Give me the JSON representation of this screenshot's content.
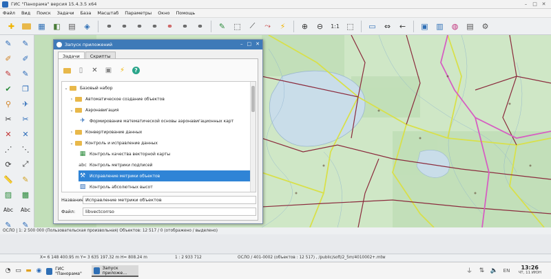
{
  "window": {
    "title": "ГИС \"Панорама\" версия 15.4.3.5 x64"
  },
  "menu": [
    "Файл",
    "Вид",
    "Поиск",
    "Задачи",
    "База",
    "Масштаб",
    "Параметры",
    "Окно",
    "Помощь"
  ],
  "toolbar": {
    "scale_label": "1:1"
  },
  "left_tools": {
    "text_label_1": "Abc",
    "text_label_2": "Abc"
  },
  "dialog": {
    "title": "Запуск приложений",
    "tabs": [
      "Задачи",
      "Скрипты"
    ],
    "tree": [
      {
        "label": "Базовый набор",
        "level": 0,
        "kind": "folder",
        "expanded": true
      },
      {
        "label": "Автоматическое создание объектов",
        "level": 1,
        "kind": "folder",
        "expanded": false
      },
      {
        "label": "Аэронавигация",
        "level": 1,
        "kind": "folder",
        "expanded": true
      },
      {
        "label": "Формирование математической основы аэронавигационных карт",
        "level": 2,
        "kind": "task"
      },
      {
        "label": "Конвертирование данных",
        "level": 1,
        "kind": "folder",
        "expanded": false
      },
      {
        "label": "Контроль и исправление данных",
        "level": 1,
        "kind": "folder",
        "expanded": true
      },
      {
        "label": "Контроль качества векторной карты",
        "level": 2,
        "kind": "task"
      },
      {
        "label": "Контроль метрики подписей",
        "level": 2,
        "kind": "task",
        "icon_text": "abc"
      },
      {
        "label": "Исправление метрики объектов",
        "level": 2,
        "kind": "task",
        "selected": true
      },
      {
        "label": "Контроль абсолютных высот",
        "level": 2,
        "kind": "task"
      }
    ],
    "name_label": "Название:",
    "name_value": "Исправление метрики объектов",
    "file_label": "Файл:",
    "file_value": "libvectcorrso"
  },
  "status": {
    "line1": "ОСЛО | 1: 2 500 000 (Пользовательская произвольная) Объектов: 12 517 / 0 (отображено / выделено)",
    "coords": "X= 6 148 400.95 m  Y= 3 635 197.32 m  H= 808.24 m",
    "scale": "1 : 2 933 712",
    "path": "ОСЛО / 401-0002  (объектов : 12 517) , /public/soft/2_5m/4010002+.mtw"
  },
  "taskbar": {
    "tasks": [
      "ГИС \"Панорама\"",
      "Запуск приложе..."
    ],
    "time": "13:26",
    "date": "ЧТ, 11 ИЮН"
  },
  "colors": {
    "map_land": "#cfe7c6",
    "water": "#c9dde9",
    "road_red": "#8a2a3c",
    "road_yellow": "#d8e04a",
    "border_magenta": "#d65ec2",
    "selection": "#2f84d6"
  }
}
